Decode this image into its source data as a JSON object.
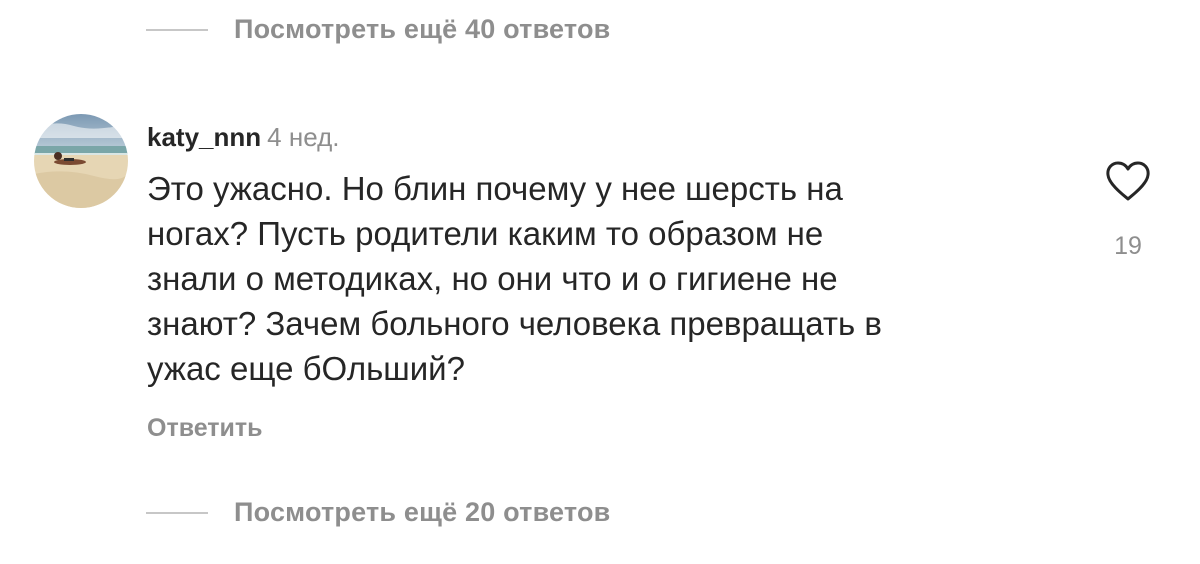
{
  "thread": {
    "view_more_top": "Посмотреть ещё 40 ответов",
    "view_more_bottom": "Посмотреть ещё 20 ответов"
  },
  "comment": {
    "username": "katy_nnn",
    "time": "4 нед.",
    "text_lines": [
      "Это ужасно. Но блин почему у нее шерсть на",
      "ногах? Пусть родители каким то образом не",
      "знали о методиках, но они что и о гигиене не",
      "знают? Зачем больного человека превращать в",
      "ужас еще бОльший?"
    ],
    "reply_label": "Ответить",
    "like_count": "19",
    "like_icon": "heart-outline-icon"
  },
  "colors": {
    "primary_text": "#262626",
    "secondary_text": "#8e8e8e",
    "divider": "#c7c7c7"
  }
}
